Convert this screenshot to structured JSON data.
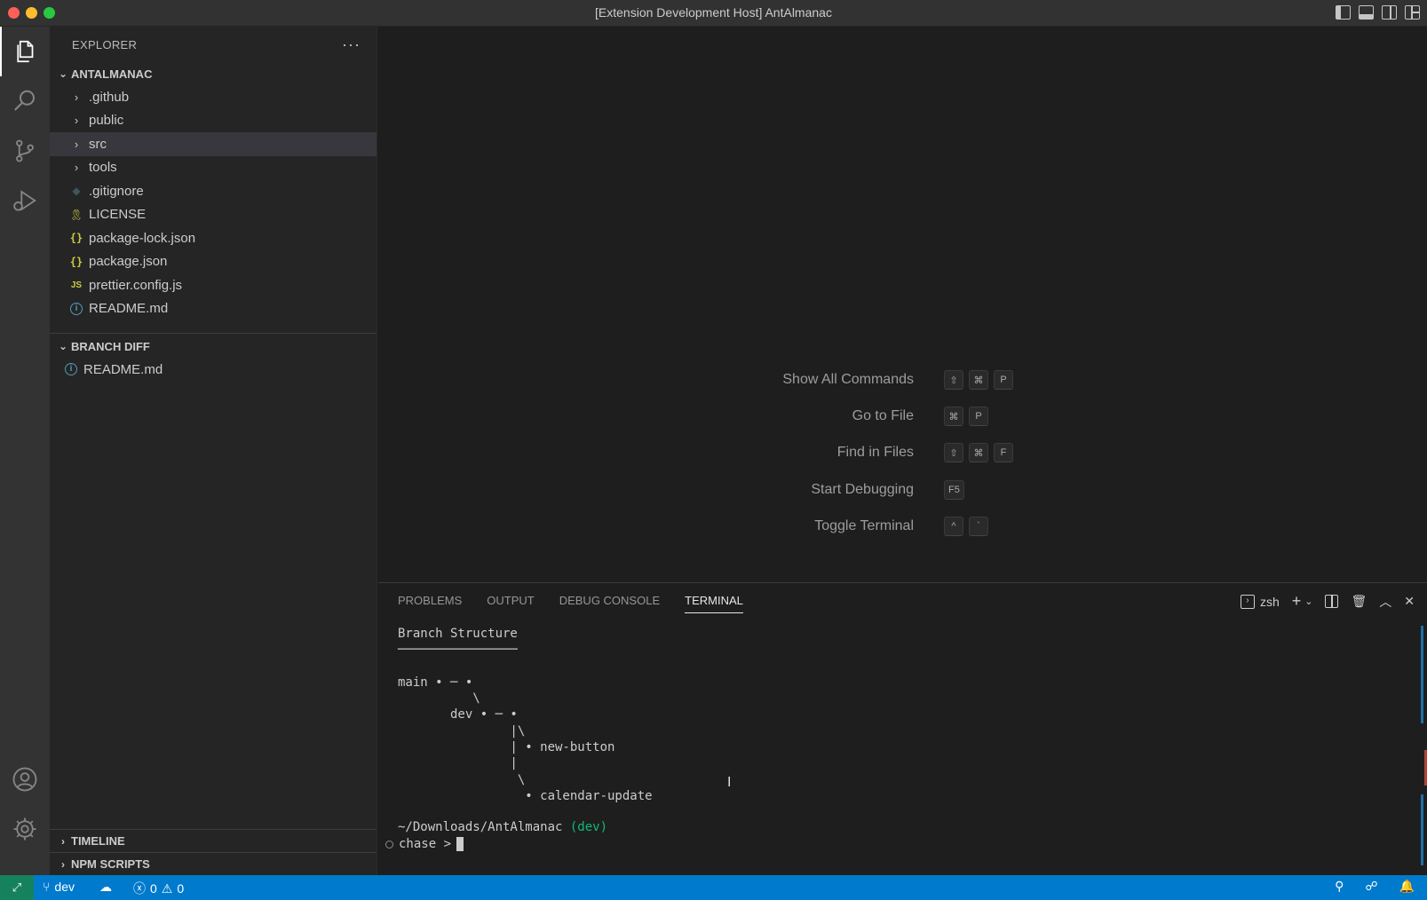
{
  "window": {
    "title": "[Extension Development Host] AntAlmanac"
  },
  "sidebar": {
    "header": "EXPLORER",
    "more_label": "···",
    "workspace": {
      "name": "ANTALMANAC",
      "items": [
        {
          "label": ".github",
          "type": "folder",
          "icon": "chevron-right-icon"
        },
        {
          "label": "public",
          "type": "folder",
          "icon": "chevron-right-icon"
        },
        {
          "label": "src",
          "type": "folder",
          "icon": "chevron-right-icon",
          "selected": true
        },
        {
          "label": "tools",
          "type": "folder",
          "icon": "chevron-right-icon"
        },
        {
          "label": ".gitignore",
          "type": "file",
          "icon": "git-icon"
        },
        {
          "label": "LICENSE",
          "type": "file",
          "icon": "license-icon"
        },
        {
          "label": "package-lock.json",
          "type": "file",
          "icon": "json-icon"
        },
        {
          "label": "package.json",
          "type": "file",
          "icon": "json-icon"
        },
        {
          "label": "prettier.config.js",
          "type": "file",
          "icon": "js-icon"
        },
        {
          "label": "README.md",
          "type": "file",
          "icon": "info-icon"
        }
      ]
    },
    "branch_diff": {
      "name": "BRANCH DIFF",
      "items": [
        {
          "label": "README.md",
          "icon": "info-icon"
        }
      ]
    },
    "timeline": "TIMELINE",
    "npm_scripts": "NPM SCRIPTS"
  },
  "editor": {
    "commands": [
      {
        "label": "Show All Commands",
        "keys": [
          "⇧",
          "⌘",
          "P"
        ]
      },
      {
        "label": "Go to File",
        "keys": [
          "⌘",
          "P"
        ]
      },
      {
        "label": "Find in Files",
        "keys": [
          "⇧",
          "⌘",
          "F"
        ]
      },
      {
        "label": "Start Debugging",
        "keys": [
          "F5"
        ]
      },
      {
        "label": "Toggle Terminal",
        "keys": [
          "^",
          "`"
        ]
      }
    ]
  },
  "panel": {
    "tabs": [
      "PROBLEMS",
      "OUTPUT",
      "DEBUG CONSOLE",
      "TERMINAL"
    ],
    "active_tab": "TERMINAL",
    "shell": "zsh",
    "terminal_lines": [
      "Branch Structure",
      "────────────────",
      "",
      "main • ─ •",
      "          \\",
      "       dev • ─ •",
      "               |\\",
      "               | • new-button",
      "               |",
      "                \\",
      "                 • calendar-update"
    ],
    "cwd": "~/Downloads/AntAlmanac",
    "branch_tag": "(dev)",
    "prompt": "chase >"
  },
  "statusbar": {
    "branch": "dev",
    "errors": "0",
    "warnings": "0"
  },
  "colors": {
    "accent": "#007acc",
    "remote": "#16825d",
    "terminal_green": "#0dbc79"
  }
}
